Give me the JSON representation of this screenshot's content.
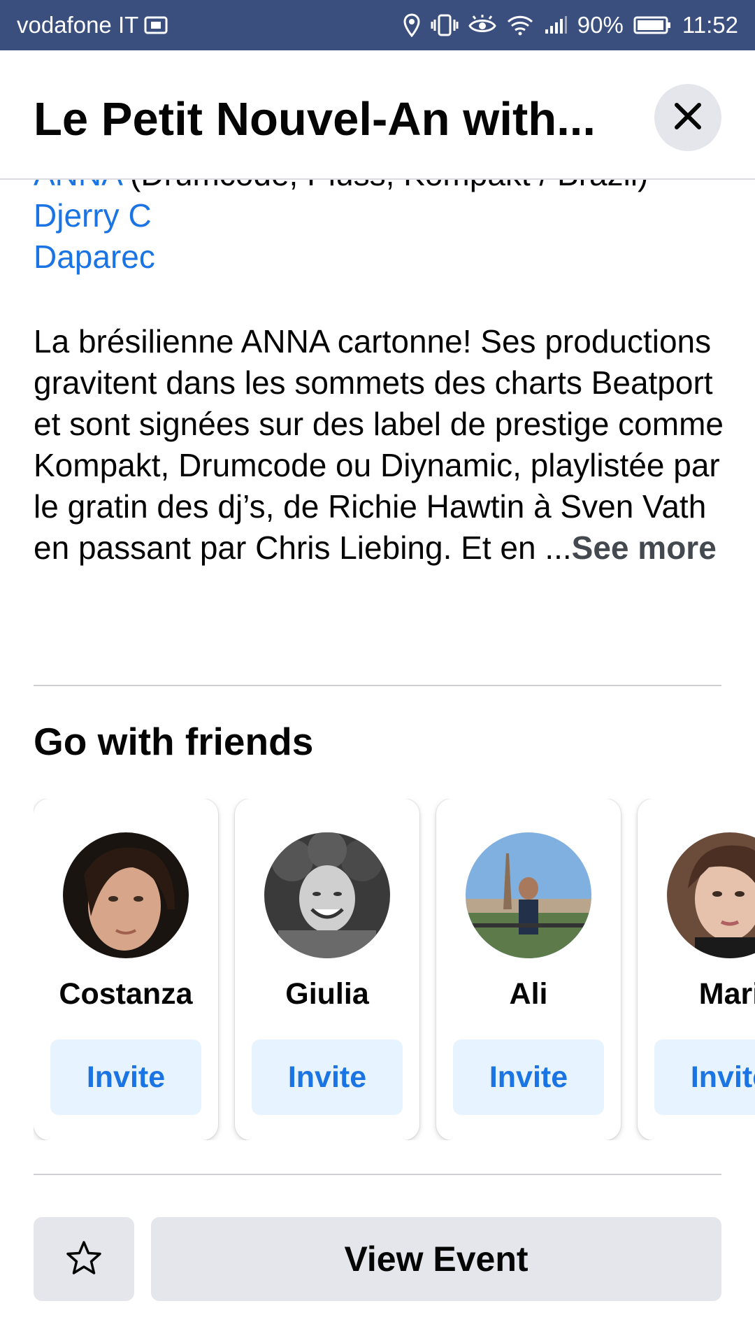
{
  "status_bar": {
    "carrier": "vodafone IT",
    "battery": "90%",
    "time": "11:52",
    "icons": [
      "sim-card-icon",
      "location-icon",
      "vibrate-icon",
      "eye-icon",
      "wifi-icon",
      "signal-icon",
      "battery-icon"
    ]
  },
  "header": {
    "title": "Le Petit Nouvel-An with...",
    "close_icon": "close-icon"
  },
  "lineup": {
    "artist1_link": "ANNA",
    "artist1_rest": " (Drumcode, Pluss, Kompakt / Brazil)",
    "artist2": "Djerry C",
    "artist3": "Daparec"
  },
  "description": {
    "text": "La brésilienne ANNA cartonne! Ses productions gravitent dans les sommets des charts Beatport et sont signées sur des label de prestige comme Kompakt, Drumcode ou Diynamic, playlistée par le gratin des dj’s, de Richie Hawtin à Sven Vath en passant par Chris Liebing. Et en ...",
    "see_more": "See more"
  },
  "friends": {
    "title": "Go with friends",
    "items": [
      {
        "name": "Costanza",
        "invite_label": "Invite"
      },
      {
        "name": "Giulia",
        "invite_label": "Invite"
      },
      {
        "name": "Ali",
        "invite_label": "Invite"
      },
      {
        "name": "Mari",
        "invite_label": "Invite"
      }
    ]
  },
  "footer": {
    "star_icon": "star-icon",
    "view_event_label": "View Event"
  },
  "colors": {
    "status_bar": "#3b4f7f",
    "link": "#1b74e4",
    "invite_bg": "#e7f3ff",
    "button_gray": "#e4e6eb"
  }
}
